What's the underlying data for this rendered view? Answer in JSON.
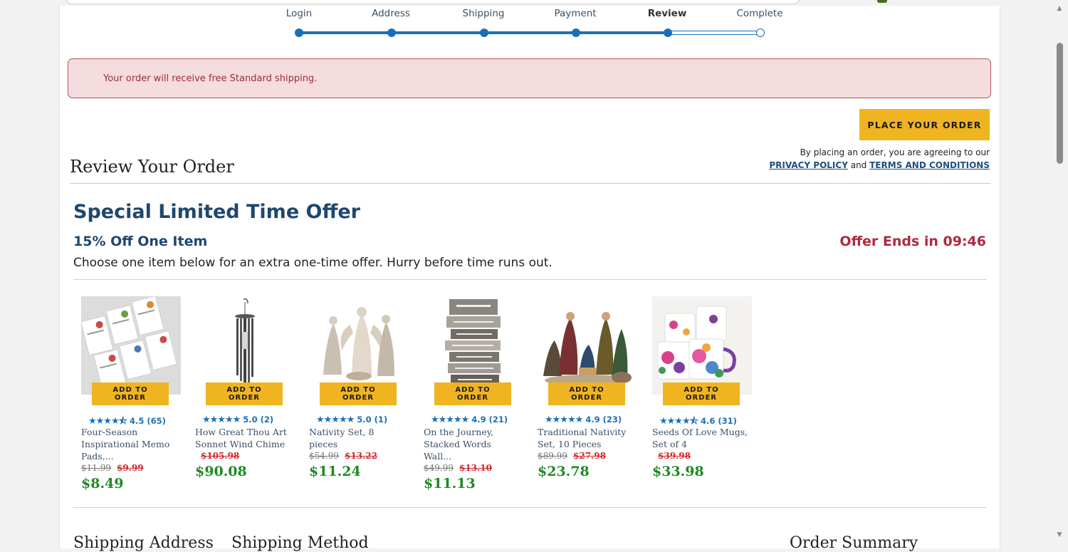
{
  "checkout_steps": [
    {
      "label": "Login",
      "state": "done"
    },
    {
      "label": "Address",
      "state": "done"
    },
    {
      "label": "Shipping",
      "state": "done"
    },
    {
      "label": "Payment",
      "state": "done"
    },
    {
      "label": "Review",
      "state": "current"
    },
    {
      "label": "Complete",
      "state": "todo"
    }
  ],
  "alert": {
    "text": "Your order will receive free Standard shipping."
  },
  "order": {
    "place_button": "PLACE YOUR ORDER",
    "agree_prefix": "By placing an order, you are agreeing to our",
    "privacy_link": "PRIVACY POLICY",
    "and": "and",
    "terms_link": "TERMS AND CONDITIONS",
    "review_title": "Review Your Order"
  },
  "offer": {
    "title": "Special Limited Time Offer",
    "subtitle": "15% Off One Item",
    "ends": "Offer Ends in 09:46",
    "description": "Choose one item below for an extra one-time offer. Hurry before time runs out."
  },
  "products": [
    {
      "name": "Four-Season Inspirational Memo Pads,...",
      "rating": "4.5 (65)",
      "stars": 4.5,
      "was_price": "$11.99",
      "sale_price": "$9.99",
      "final_price": "$8.49",
      "button": "ADD TO ORDER",
      "image": "memo-pads-image"
    },
    {
      "name": "How Great Thou Art Sonnet Wind Chime",
      "rating": "5.0 (2)",
      "stars": 5,
      "was_price": "",
      "sale_price": "$105.98",
      "final_price": "$90.08",
      "button": "ADD TO ORDER",
      "image": "wind-chime-image"
    },
    {
      "name": "Nativity Set, 8 pieces",
      "rating": "5.0 (1)",
      "stars": 5,
      "was_price": "$54.99",
      "sale_price": "$13.22",
      "final_price": "$11.24",
      "button": "ADD TO ORDER",
      "image": "nativity-figurines-image"
    },
    {
      "name": "On the Journey, Stacked Words Wall...",
      "rating": "4.9 (21)",
      "stars": 4.9,
      "was_price": "$49.99",
      "sale_price": "$13.10",
      "final_price": "$11.13",
      "button": "ADD TO ORDER",
      "image": "wall-sign-image"
    },
    {
      "name": "Traditional Nativity Set, 10 Pieces",
      "rating": "4.9 (23)",
      "stars": 4.9,
      "was_price": "$89.99",
      "sale_price": "$27.98",
      "final_price": "$23.78",
      "button": "ADD TO ORDER",
      "image": "traditional-nativity-image"
    },
    {
      "name": "Seeds Of Love Mugs, Set of 4",
      "rating": "4.6 (31)",
      "stars": 4.6,
      "was_price": "",
      "sale_price": "$39.98",
      "final_price": "$33.98",
      "button": "ADD TO ORDER",
      "image": "floral-mugs-image"
    }
  ],
  "sections": {
    "shipping_address": "Shipping Address",
    "shipping_method": "Shipping Method",
    "order_summary": "Order Summary"
  },
  "colors": {
    "accent_blue": "#1a70b8",
    "heading_navy": "#20476d",
    "button_gold": "#f0b421",
    "alert_bg": "#f5dcde",
    "alert_border": "#b5535e",
    "price_green": "#1f8a22",
    "sale_red": "#d4252c",
    "timer_red": "#b02a3c"
  }
}
